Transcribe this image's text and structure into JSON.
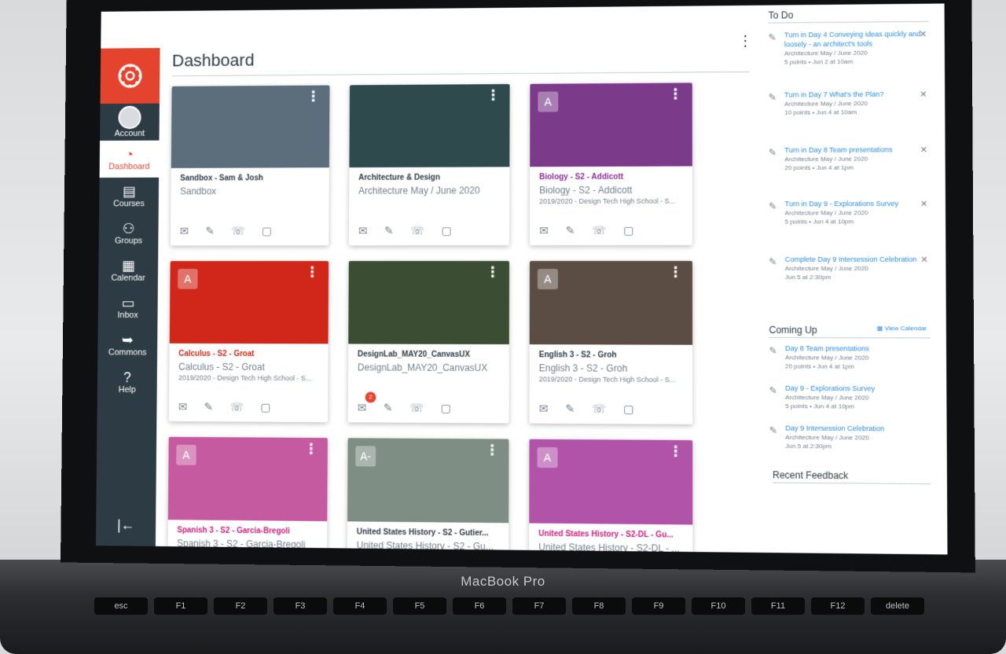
{
  "device": {
    "label": "MacBook Pro"
  },
  "keyboard": {
    "keys": [
      "esc",
      "F1",
      "F2",
      "F3",
      "F4",
      "F5",
      "F6",
      "F7",
      "F8",
      "F9",
      "F10",
      "F11",
      "F12",
      "delete"
    ]
  },
  "nav": {
    "items": [
      {
        "label": "Account",
        "icon": "avatar"
      },
      {
        "label": "Dashboard",
        "icon": "dashboard-icon",
        "active": true
      },
      {
        "label": "Courses",
        "icon": "courses-icon"
      },
      {
        "label": "Groups",
        "icon": "groups-icon"
      },
      {
        "label": "Calendar",
        "icon": "calendar-icon"
      },
      {
        "label": "Inbox",
        "icon": "inbox-icon"
      },
      {
        "label": "Commons",
        "icon": "commons-icon"
      },
      {
        "label": "Help",
        "icon": "help-icon"
      }
    ],
    "collapse_icon": "|←",
    "brand_color": "#e4432e",
    "bg_color": "#2d3b45"
  },
  "header": {
    "title": "Dashboard"
  },
  "cards": [
    {
      "color": "#5c6e7c",
      "grade": "",
      "code": "Sandbox - Sam & Josh",
      "name": "Sandbox",
      "term": "",
      "code_color": "#2d3b45",
      "badge": ""
    },
    {
      "color": "#2f4a4d",
      "grade": "",
      "code": "Architecture & Design",
      "name": "Architecture May / June 2020",
      "term": "",
      "code_color": "#2d3b45",
      "badge": ""
    },
    {
      "color": "#7b3a8a",
      "grade": "A",
      "code": "Biology - S2 - Addicott",
      "name": "Biology - S2 - Addicott",
      "term": "2019/2020 - Design Tech High School - S...",
      "code_color": "#8b2d9a",
      "badge": ""
    },
    {
      "color": "#d1271a",
      "grade": "A",
      "code": "Calculus - S2 - Groat",
      "name": "Calculus - S2 - Groat",
      "term": "2019/2020 - Design Tech High School - S...",
      "code_color": "#d1271a",
      "badge": ""
    },
    {
      "color": "#3b4d32",
      "grade": "",
      "code": "DesignLab_MAY20_CanvasUX",
      "name": "DesignLab_MAY20_CanvasUX",
      "term": "",
      "code_color": "#2d3b45",
      "badge": "2"
    },
    {
      "color": "#5b4d43",
      "grade": "A",
      "code": "English 3 - S2 - Groh",
      "name": "English 3 - S2 - Groh",
      "term": "2019/2020 - Design Tech High School - S...",
      "code_color": "#2d3b45",
      "badge": ""
    },
    {
      "color": "#c65aa0",
      "grade": "A",
      "code": "Spanish 3 - S2 - Garcia-Bregoli",
      "name": "Spanish 3 - S2 - Garcia-Bregoli",
      "term": "",
      "code_color": "#cc1f7a",
      "badge": ""
    },
    {
      "color": "#7f8e84",
      "grade": "A-",
      "code": "United States History - S2 - Gutier...",
      "name": "United States History - S2 - Gu...",
      "term": "",
      "code_color": "#2d3b45",
      "badge": ""
    },
    {
      "color": "#b153a9",
      "grade": "A",
      "code": "United States History - S2-DL - Gu...",
      "name": "United States History - S2-DL - ...",
      "term": "",
      "code_color": "#cc1f7a",
      "badge": ""
    }
  ],
  "todo": {
    "title": "To Do",
    "items": [
      {
        "text": "Turn in Day 4 Conveying ideas quickly and loosely - an architect's tools",
        "course": "Architecture May / June 2020",
        "meta": "5 points • Jun 2 at 10am"
      },
      {
        "text": "Turn in Day 7 What's the Plan?",
        "course": "Architecture May / June 2020",
        "meta": "10 points • Jun 4 at 10am"
      },
      {
        "text": "Turn in Day 8 Team presentations",
        "course": "Architecture May / June 2020",
        "meta": "20 points • Jun 4 at 1pm"
      },
      {
        "text": "Turn in Day 9 - Explorations Survey",
        "course": "Architecture May / June 2020",
        "meta": "5 points • Jun 4 at 10pm"
      },
      {
        "text": "Complete Day 9 Intersession Celebration",
        "course": "Architecture May / June 2020",
        "meta": "Jun 5 at 2:30pm"
      }
    ]
  },
  "coming_up": {
    "title": "Coming Up",
    "view_calendar": "View Calendar",
    "items": [
      {
        "text": "Day 8 Team presentations",
        "course": "Architecture May / June 2020",
        "meta": "20 points • Jun 4 at 1pm"
      },
      {
        "text": "Day 9 - Explorations Survey",
        "course": "Architecture May / June 2020",
        "meta": "5 points • Jun 4 at 10pm"
      },
      {
        "text": "Day 9 Intersession Celebration",
        "course": "Architecture May / June 2020",
        "meta": "Jun 5 at 2:30pm"
      }
    ]
  },
  "recent_feedback": {
    "title": "Recent Feedback"
  }
}
